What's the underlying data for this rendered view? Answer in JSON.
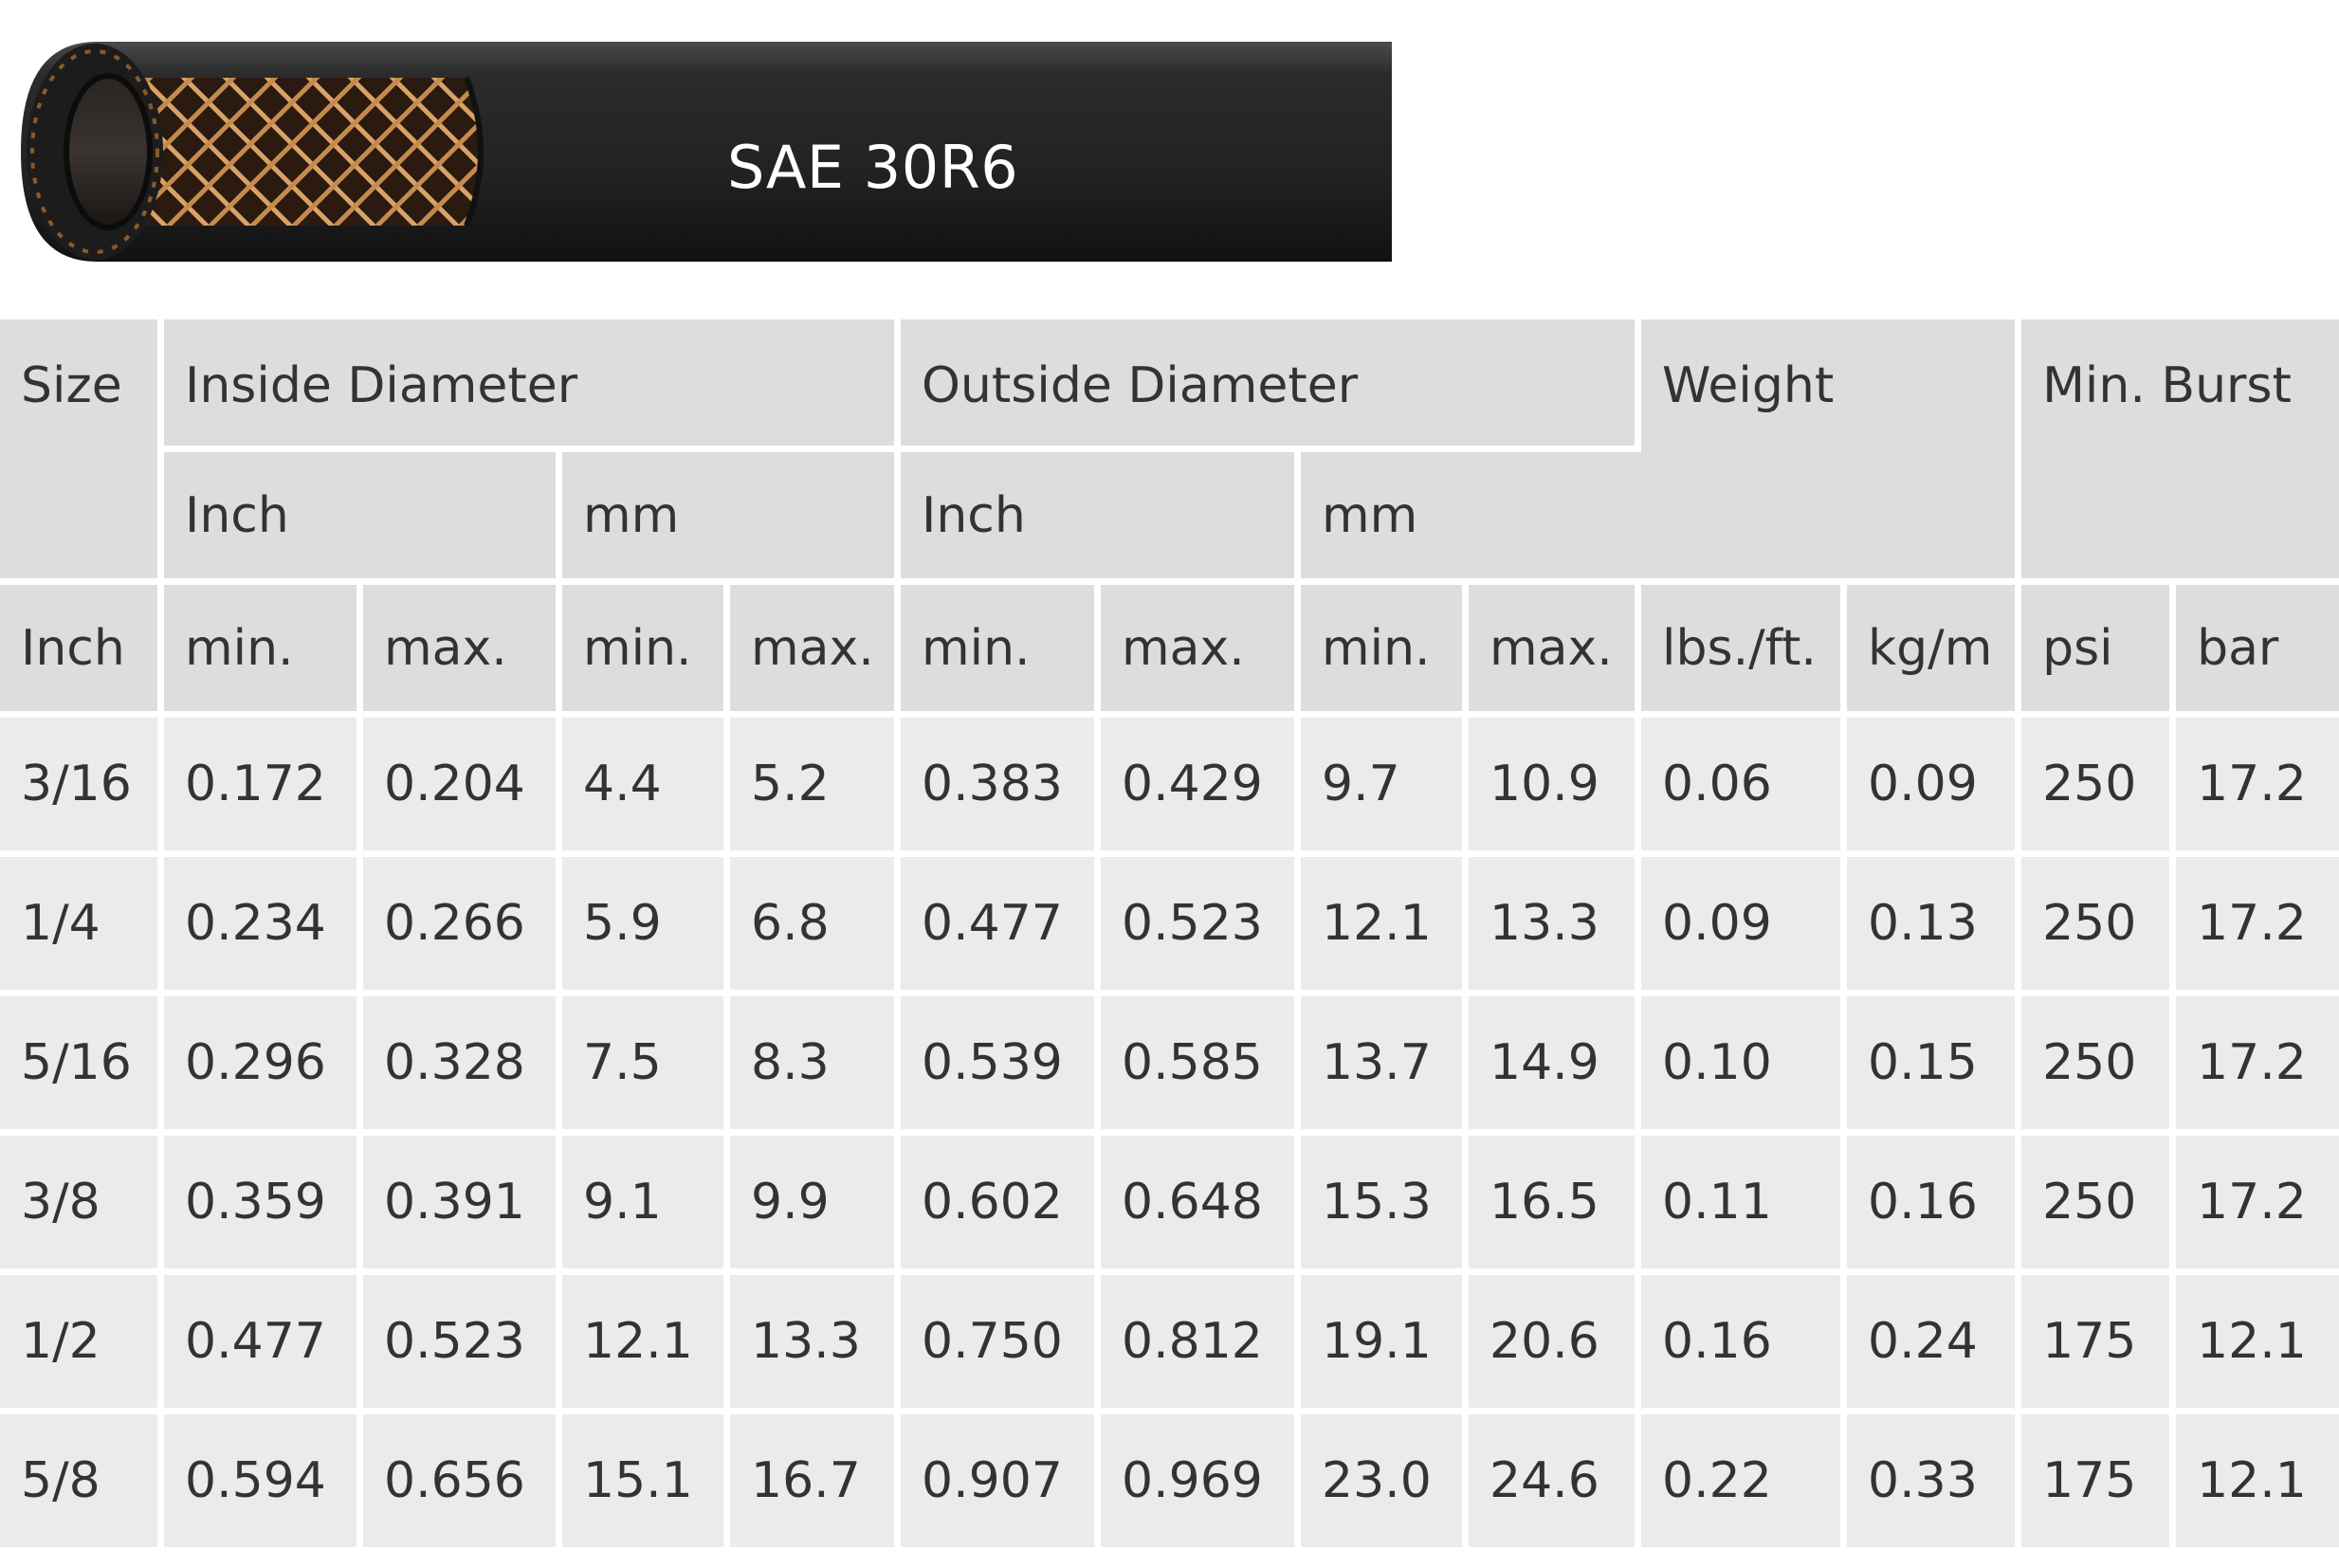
{
  "banner": {
    "title": "SAE 30R6",
    "image_icon": "braided-hose-image"
  },
  "table": {
    "header_row_1": {
      "size": "Size",
      "inside_diameter": "Inside Diameter",
      "outside_diameter": "Outside Diameter",
      "weight": "Weight",
      "min_burst": "Min. Burst"
    },
    "header_row_2": {
      "id_inch": "Inch",
      "id_mm": "mm",
      "od_inch": "Inch",
      "od_mm": "mm"
    },
    "header_row_3": {
      "size_unit": "Inch",
      "id_inch_min": "min.",
      "id_inch_max": "max.",
      "id_mm_min": "min.",
      "id_mm_max": "max.",
      "od_inch_min": "min.",
      "od_inch_max": "max.",
      "od_mm_min": "min.",
      "od_mm_max": "max.",
      "weight_lbs": "lbs./ft.",
      "weight_kg": "kg/m",
      "burst_psi": "psi",
      "burst_bar": "bar"
    },
    "rows": [
      [
        "3/16",
        "0.172",
        "0.204",
        "4.4",
        "5.2",
        "0.383",
        "0.429",
        "9.7",
        "10.9",
        "0.06",
        "0.09",
        "250",
        "17.2"
      ],
      [
        "1/4",
        "0.234",
        "0.266",
        "5.9",
        "6.8",
        "0.477",
        "0.523",
        "12.1",
        "13.3",
        "0.09",
        "0.13",
        "250",
        "17.2"
      ],
      [
        "5/16",
        "0.296",
        "0.328",
        "7.5",
        "8.3",
        "0.539",
        "0.585",
        "13.7",
        "14.9",
        "0.10",
        "0.15",
        "250",
        "17.2"
      ],
      [
        "3/8",
        "0.359",
        "0.391",
        "9.1",
        "9.9",
        "0.602",
        "0.648",
        "15.3",
        "16.5",
        "0.11",
        "0.16",
        "250",
        "17.2"
      ],
      [
        "1/2",
        "0.477",
        "0.523",
        "12.1",
        "13.3",
        "0.750",
        "0.812",
        "19.1",
        "20.6",
        "0.16",
        "0.24",
        "175",
        "12.1"
      ],
      [
        "5/8",
        "0.594",
        "0.656",
        "15.1",
        "16.7",
        "0.907",
        "0.969",
        "23.0",
        "24.6",
        "0.22",
        "0.33",
        "175",
        "12.1"
      ]
    ]
  }
}
